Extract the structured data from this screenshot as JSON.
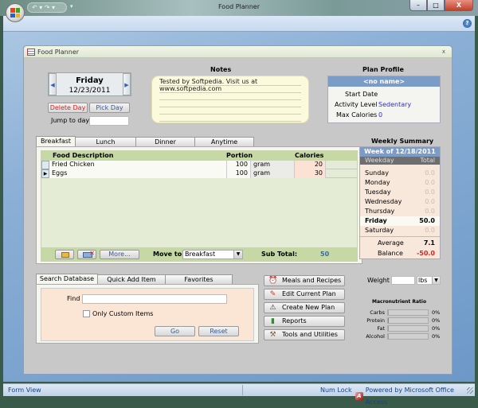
{
  "window": {
    "title": "Food Planner",
    "controls": {
      "minimize": "–",
      "maximize": "□",
      "close": "X"
    }
  },
  "quick_access": {
    "undo": "↶ ▾ ↷ ▾",
    "customize": "▾"
  },
  "ribbon": {
    "help_icon": "?"
  },
  "form": {
    "title": "Food Planner",
    "close": "x"
  },
  "day": {
    "name": "Friday",
    "date": "12/23/2011",
    "prev_icon": "◀",
    "next_icon": "▶",
    "delete_label": "Delete Day",
    "pick_label": "Pick Day",
    "jump_label": "Jump to day",
    "jump_value": ""
  },
  "notes": {
    "title": "Notes",
    "text": "Tested by Softpedia. Visit us at www.softpedia.com"
  },
  "plan_profile": {
    "title": "Plan Profile",
    "name": "<no name>",
    "start_date_label": "Start Date",
    "start_date": "",
    "activity_label": "Activity Level",
    "activity": "Sedentary",
    "max_cal_label": "Max Calories",
    "max_cal": "0"
  },
  "meal_tabs": [
    {
      "label": "Breakfast",
      "active": true
    },
    {
      "label": "Lunch",
      "active": false
    },
    {
      "label": "Dinner",
      "active": false
    },
    {
      "label": "Anytime",
      "active": false
    }
  ],
  "food_grid": {
    "columns": {
      "desc": "Food Description",
      "portion": "Portion",
      "calories": "Calories"
    },
    "rows": [
      {
        "desc": "Fried Chicken",
        "portion": "100",
        "unit": "gram",
        "calories": "20",
        "current": false
      },
      {
        "desc": "Eggs",
        "portion": "100",
        "unit": "gram",
        "calories": "30",
        "current": true
      }
    ],
    "more_label": "More...",
    "move_to_label": "Move to",
    "move_to_value": "Breakfast",
    "subtotal_label": "Sub Total:",
    "subtotal_value": "50"
  },
  "weekly_summary": {
    "title": "Weekly Summary",
    "week_label": "Week of  12/18/2011",
    "col_day": "Weekday",
    "col_total": "Total",
    "days": [
      {
        "day": "Sunday",
        "total": "0.0"
      },
      {
        "day": "Monday",
        "total": "0.0"
      },
      {
        "day": "Tuesday",
        "total": "0.0"
      },
      {
        "day": "Wednesday",
        "total": "0.0"
      },
      {
        "day": "Thursday",
        "total": "0.0"
      },
      {
        "day": "Friday",
        "total": "50.0"
      },
      {
        "day": "Saturday",
        "total": "0.0"
      }
    ],
    "current_day": "Friday",
    "average_label": "Average",
    "average": "7.1",
    "balance_label": "Balance",
    "balance": "-50.0"
  },
  "search_tabs": [
    {
      "label": "Search Database",
      "active": true
    },
    {
      "label": "Quick Add Item",
      "active": false
    },
    {
      "label": "Favorites",
      "active": false
    }
  ],
  "search": {
    "find_label": "Find",
    "find_value": "",
    "custom_only_label": "Only Custom Items",
    "custom_only_checked": false,
    "go_label": "Go",
    "reset_label": "Reset"
  },
  "nav_buttons": [
    {
      "label": "Meals and Recipes",
      "icon": "⏰"
    },
    {
      "label": "Edit Current Plan",
      "icon": "✎"
    },
    {
      "label": "Create New Plan",
      "icon": "⚠"
    },
    {
      "label": "Reports",
      "icon": "▮"
    },
    {
      "label": "Tools and Utilities",
      "icon": "⚒"
    }
  ],
  "weight": {
    "label": "Weight",
    "value": "",
    "unit": "lbs"
  },
  "macros": {
    "title": "Macronutrient Ratio",
    "items": [
      {
        "label": "Carbs",
        "pct": "0%",
        "color": "#a0a0a0"
      },
      {
        "label": "Protein",
        "pct": "0%",
        "color": "#e06060"
      },
      {
        "label": "Fat",
        "pct": "0%",
        "color": "#90b060"
      },
      {
        "label": "Alcohol",
        "pct": "0%",
        "color": "#a0a0a0"
      }
    ]
  },
  "status": {
    "mode": "Form View",
    "numlock": "Num Lock",
    "powered": "Powered by Microsoft Office Access"
  },
  "colors": {
    "accent_blue": "#7c9cc8",
    "delete_red": "#e02020",
    "value_blue": "#2a2ae0",
    "balance_red": "#e02020"
  }
}
